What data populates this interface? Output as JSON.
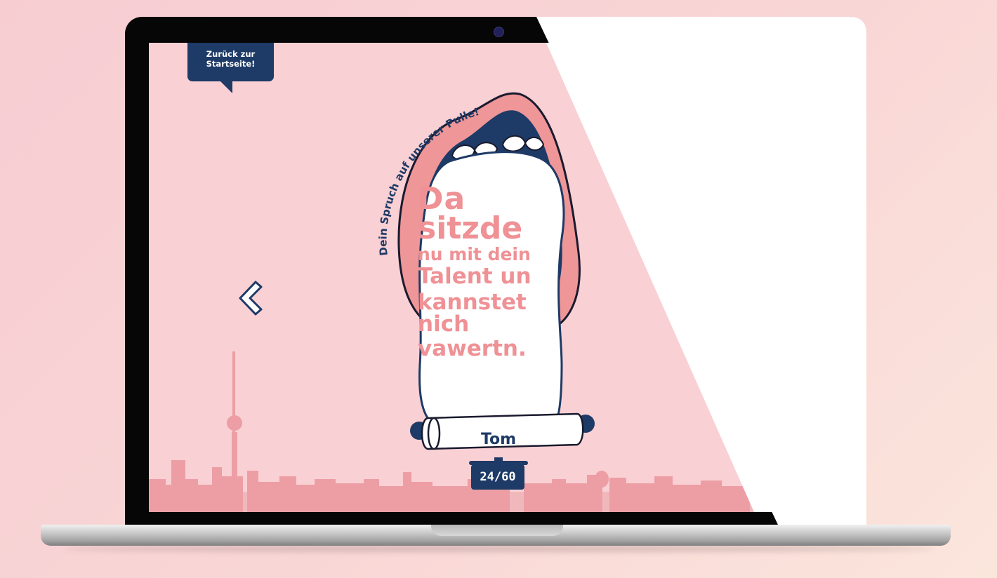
{
  "back_button": {
    "line1": "Zurück zur",
    "line2": "Startseite!"
  },
  "arc_caption": "Dein Spruch auf unserer Pulle!",
  "quote": {
    "lines": [
      "Da",
      "sitzde",
      "nu mit dein",
      "Talent un",
      "kannstet",
      "nich",
      "vawertn."
    ]
  },
  "author": "Tom",
  "counter": "24/60",
  "colors": {
    "navy": "#1e3a66",
    "pink_text": "#ef9195",
    "screen_bg": "#f9d0d4",
    "lips": "#ee9698",
    "skyline": "#ec9ea4"
  },
  "icons": [
    "chevron-left-icon",
    "webcam-icon"
  ]
}
